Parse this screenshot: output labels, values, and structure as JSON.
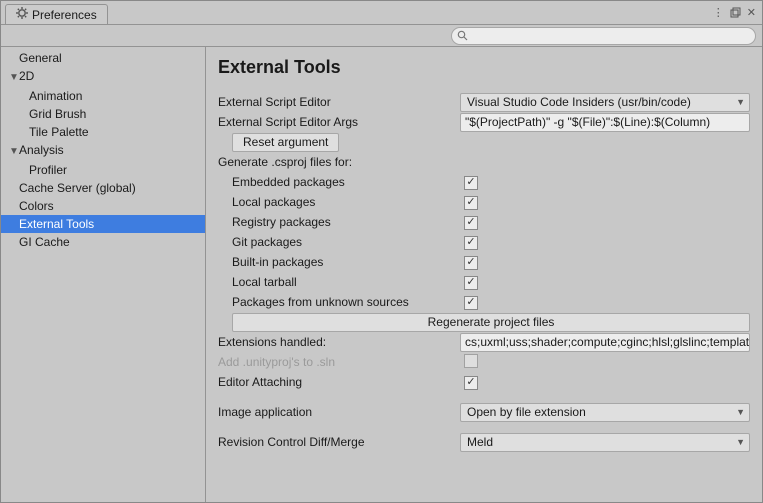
{
  "window": {
    "title": "Preferences"
  },
  "search": {
    "placeholder": ""
  },
  "sidebar": {
    "items": [
      {
        "label": "General"
      },
      {
        "label": "2D",
        "exp": true
      },
      {
        "label": "Animation"
      },
      {
        "label": "Grid Brush"
      },
      {
        "label": "Tile Palette"
      },
      {
        "label": "Analysis",
        "exp": true
      },
      {
        "label": "Profiler"
      },
      {
        "label": "Cache Server (global)"
      },
      {
        "label": "Colors"
      },
      {
        "label": "External Tools"
      },
      {
        "label": "GI Cache"
      }
    ]
  },
  "heading": "External Tools",
  "rows": {
    "ext_editor": {
      "label": "External Script Editor",
      "value": "Visual Studio Code Insiders (usr/bin/code)"
    },
    "ext_args": {
      "label": "External Script Editor Args",
      "value": "\"$(ProjectPath)\" -g \"$(File)\":$(Line):$(Column)"
    },
    "reset_btn": "Reset argument",
    "gen_label": "Generate .csproj files for:",
    "cb": [
      {
        "label": "Embedded packages",
        "checked": true
      },
      {
        "label": "Local packages",
        "checked": true
      },
      {
        "label": "Registry packages",
        "checked": true
      },
      {
        "label": "Git packages",
        "checked": true
      },
      {
        "label": "Built-in packages",
        "checked": true
      },
      {
        "label": "Local tarball",
        "checked": true
      },
      {
        "label": "Packages from unknown sources",
        "checked": true
      }
    ],
    "regen_btn": "Regenerate project files",
    "ext_handled": {
      "label": "Extensions handled:",
      "value": "cs;uxml;uss;shader;compute;cginc;hlsl;glslinc;template"
    },
    "add_sln": {
      "label": "Add .unityproj's to .sln",
      "checked": false,
      "disabled": true
    },
    "attach": {
      "label": "Editor Attaching",
      "checked": true
    },
    "img_app": {
      "label": "Image application",
      "value": "Open by file extension"
    },
    "rev": {
      "label": "Revision Control Diff/Merge",
      "value": "Meld"
    }
  }
}
